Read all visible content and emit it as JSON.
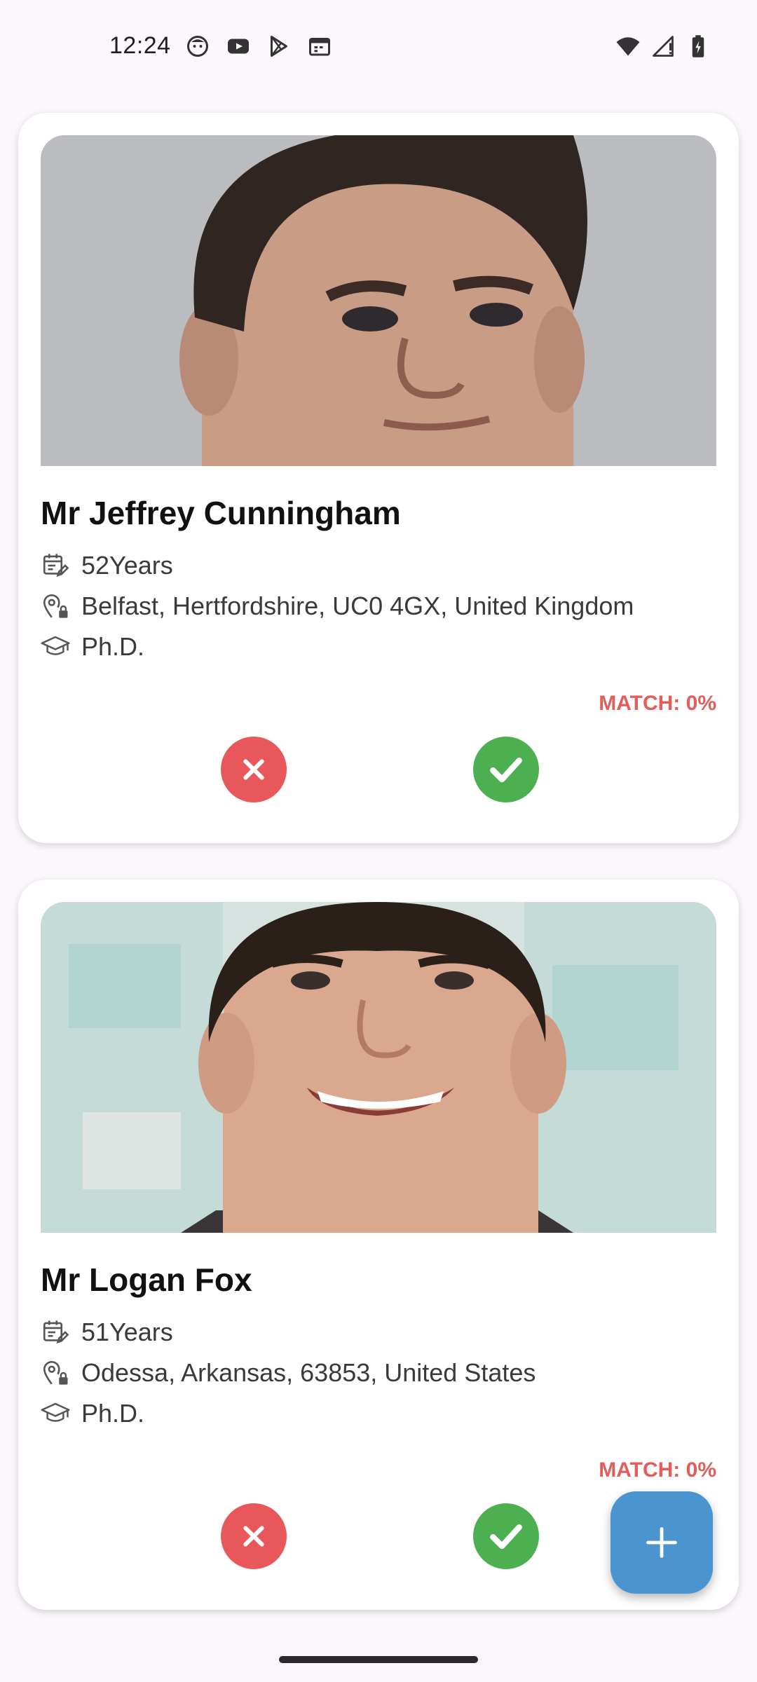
{
  "status_bar": {
    "time": "12:24",
    "left_icons": [
      "face-notification-icon",
      "youtube-icon",
      "play-store-icon",
      "calendar-icon"
    ],
    "right_icons": [
      "wifi-icon",
      "cell-signal-icon",
      "battery-charging-icon"
    ]
  },
  "colors": {
    "background": "#fbf7fc",
    "match": "#e35d5b",
    "reject": "#e8575a",
    "accept": "#4caf50",
    "fab": "#4a95cf"
  },
  "cards": [
    {
      "name": "Mr Jeffrey Cunningham",
      "age": "52Years",
      "location": "Belfast, Hertfordshire, UC0 4GX, United Kingdom",
      "education": "Ph.D.",
      "match": "MATCH: 0%"
    },
    {
      "name": "Mr Logan Fox",
      "age": "51Years",
      "location": "Odessa, Arkansas, 63853, United States",
      "education": "Ph.D.",
      "match": "MATCH: 0%"
    }
  ],
  "fab": {
    "icon": "plus-icon"
  }
}
